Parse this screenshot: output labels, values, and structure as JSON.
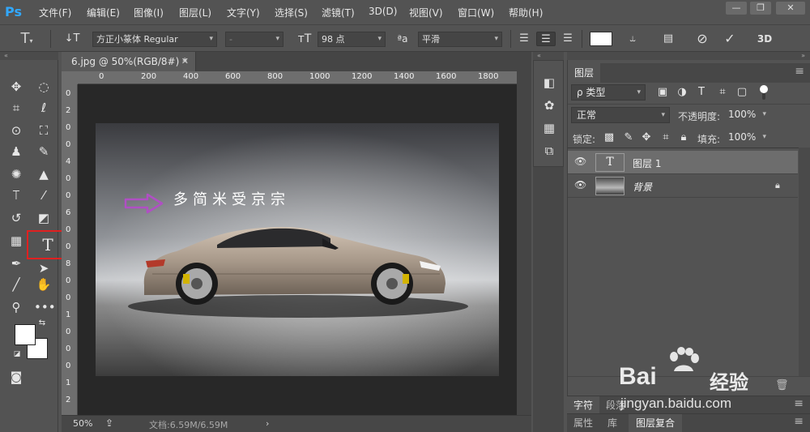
{
  "app": {
    "logo": "Ps"
  },
  "menu": {
    "items": [
      "文件(F)",
      "编辑(E)",
      "图像(I)",
      "图层(L)",
      "文字(Y)",
      "选择(S)",
      "滤镜(T)",
      "3D(D)",
      "视图(V)",
      "窗口(W)",
      "帮助(H)"
    ],
    "window_controls": [
      "—",
      "❐",
      "✕"
    ]
  },
  "options": {
    "font_family": "方正小篆体 Regular",
    "font_style": "-",
    "font_size": "98 点",
    "antialias": "平滑"
  },
  "document": {
    "tab_title": "6.jpg @ 50%(RGB/8#) *",
    "ruler_top_ticks": [
      "0",
      "200",
      "400",
      "600",
      "800",
      "1000",
      "1200",
      "1400",
      "1600",
      "1800"
    ],
    "ruler_left_ticks": [
      "0",
      "2",
      "0",
      "0",
      "4",
      "0",
      "0",
      "6",
      "0",
      "0",
      "8",
      "0",
      "0",
      "1",
      "0",
      "0",
      "0",
      "1",
      "2"
    ],
    "zoom": "50%",
    "doc_size": "文档:6.59M/6.59M",
    "canvas_text": "多简米受京宗",
    "annotation_arrow_color": "#b04fc4",
    "highlight_color": "#e02020"
  },
  "layers_panel": {
    "title": "图层",
    "filter_kind": "ρ 类型",
    "blend_mode": "正常",
    "opacity_label": "不透明度:",
    "opacity_value": "100%",
    "lock_label": "锁定:",
    "fill_label": "填充:",
    "fill_value": "100%",
    "layers": [
      {
        "name": "图层 1",
        "kind": "text",
        "selected": true
      },
      {
        "name": "背景",
        "kind": "image",
        "selected": false,
        "locked": true
      }
    ]
  },
  "bottom_panels": {
    "row1": [
      "字符",
      "段落"
    ],
    "row2": [
      "属性",
      "库",
      "图层复合"
    ]
  },
  "watermark": {
    "brand": "Bai",
    "brand_cn": "经验",
    "url": "jingyan.baidu.com"
  }
}
